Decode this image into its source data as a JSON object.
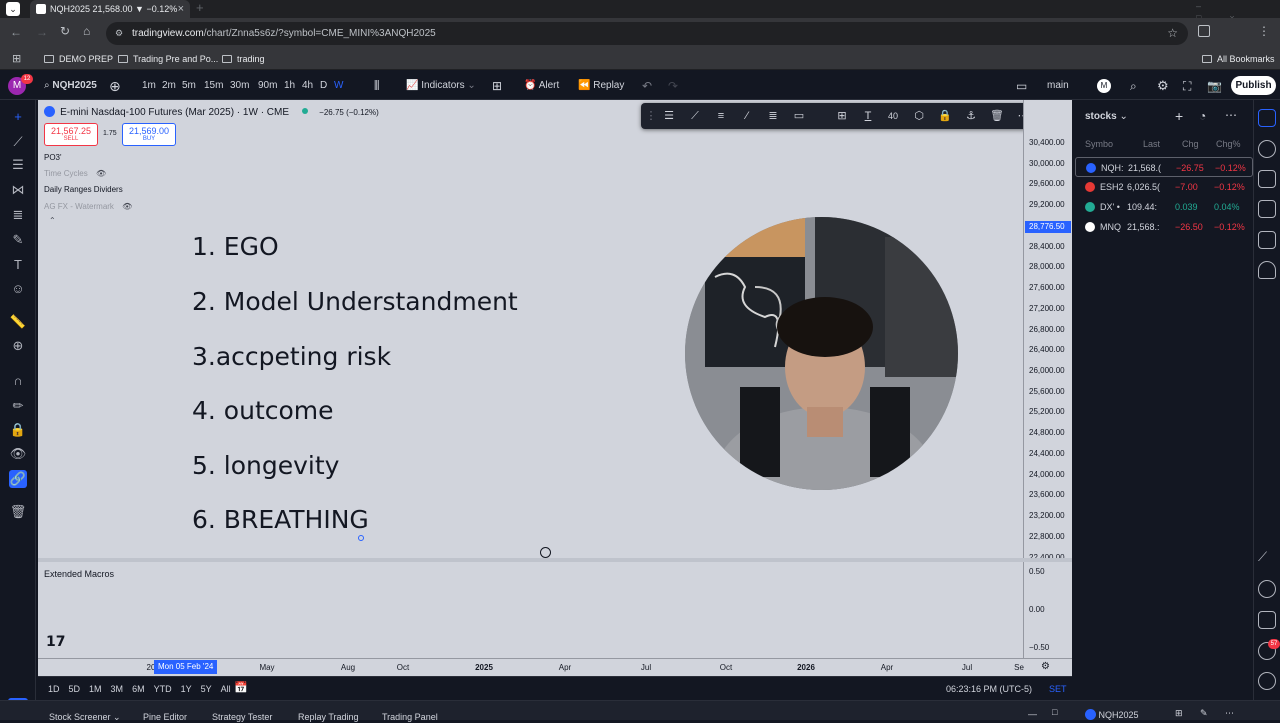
{
  "browser": {
    "tab_title": "NQH2025 21,568.00 ▼ −0.12%",
    "url_host": "tradingview.com",
    "url_path": "/chart/Znna5s6z/?symbol=CME_MINI%3ANQH2025",
    "bookmarks": [
      "DEMO PREP",
      "Trading Pre and Po...",
      "trading"
    ],
    "all_bookmarks": "All Bookmarks"
  },
  "toolbar": {
    "avatar_letter": "M",
    "notif_count": "12",
    "symbol": "NQH2025",
    "intervals": [
      "1m",
      "2m",
      "5m",
      "15m",
      "30m",
      "90m",
      "1h",
      "4h",
      "D",
      "W"
    ],
    "active_interval": "W",
    "indicators": "Indicators",
    "alert": "Alert",
    "replay": "Replay",
    "layout_name": "main",
    "publish": "Publish"
  },
  "legend": {
    "title": "E-mini Nasdaq-100 Futures (Mar 2025) · 1W · CME",
    "change": "−26.75 (−0.12%)",
    "sell_price": "21,567.25",
    "sell_label": "SELL",
    "spread": "1.75",
    "buy_price": "21,569.00",
    "buy_label": "BUY",
    "indicators": [
      "PO3'",
      "Time Cycles",
      "Daily Ranges Dividers",
      "AG FX - Watermark"
    ]
  },
  "overlay_list": [
    "1. EGO",
    "2. Model Understandment",
    "3.accpeting risk",
    "4. outcome",
    "5. longevity",
    "6. BREATHING"
  ],
  "drawing_toolbar": {
    "font_size": "40"
  },
  "price_axis": {
    "labels": [
      "30,400.00",
      "30,000.00",
      "29,600.00",
      "29,200.00",
      "28,400.00",
      "28,000.00",
      "27,600.00",
      "27,200.00",
      "26,800.00",
      "26,400.00",
      "26,000.00",
      "25,600.00",
      "25,200.00",
      "24,800.00",
      "24,400.00",
      "24,000.00",
      "23,600.00",
      "23,200.00",
      "22,800.00",
      "22,400.00"
    ],
    "highlight": "28,776.50",
    "lower_labels": [
      "0.50",
      "0.00",
      "−0.50"
    ]
  },
  "lower_pane": {
    "title": "Extended Macros"
  },
  "time_axis": {
    "cursor_label": "Mon 05 Feb '24",
    "partial": "20",
    "labels": [
      "May",
      "Aug",
      "Oct",
      "2025",
      "Apr",
      "Jul",
      "Oct",
      "2026",
      "Apr",
      "Jul",
      "Se"
    ]
  },
  "bottom": {
    "ranges": [
      "1D",
      "5D",
      "1M",
      "3M",
      "6M",
      "YTD",
      "1Y",
      "5Y",
      "All"
    ],
    "clock": "06:23:16 PM (UTC-5)",
    "session": "SET"
  },
  "footer": {
    "tabs": [
      "Stock Screener",
      "Pine Editor",
      "Strategy Tester",
      "Replay Trading",
      "Trading Panel"
    ],
    "symbol": "NQH2025"
  },
  "watchlist": {
    "title": "stocks",
    "headers": [
      "Symbo",
      "Last",
      "Chg",
      "Chg%"
    ],
    "rows": [
      {
        "sym": "NQH:",
        "last": "21,568.(",
        "chg": "−26.75",
        "pct": "−0.12%",
        "color": "#f23645",
        "badge": "#2962ff"
      },
      {
        "sym": "ESH2",
        "last": "6,026.5(",
        "chg": "−7.00",
        "pct": "−0.12%",
        "color": "#f23645",
        "badge": "#e53935"
      },
      {
        "sym": "DX' •",
        "last": "109.44:",
        "chg": "0.039",
        "pct": "0.04%",
        "color": "#22ab94",
        "badge": "#22ab94"
      },
      {
        "sym": "MNQ",
        "last": "21,568.:",
        "chg": "−26.50",
        "pct": "−0.12%",
        "color": "#f23645",
        "badge": "#ffffff"
      }
    ]
  },
  "alerts_count": "57",
  "colors": {
    "accent": "#2962ff",
    "down": "#f23645",
    "up": "#22ab94"
  }
}
